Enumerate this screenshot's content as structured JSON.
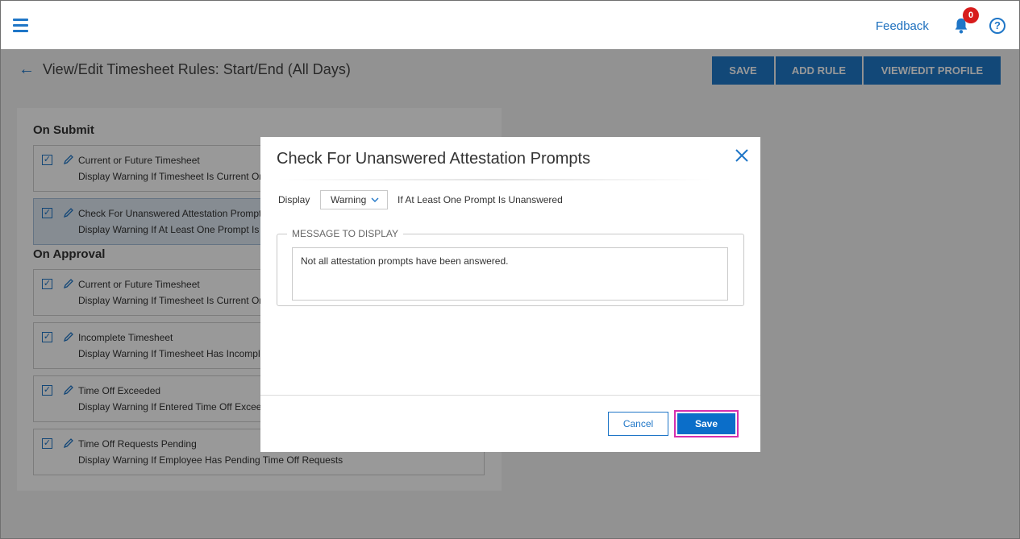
{
  "header": {
    "feedback_label": "Feedback",
    "notification_count": "0",
    "help_label": "?"
  },
  "page": {
    "title": "View/Edit Timesheet Rules: Start/End (All Days)",
    "buttons": {
      "save": "SAVE",
      "add_rule": "ADD RULE",
      "view_edit_profile": "VIEW/EDIT PROFILE"
    },
    "sections": [
      {
        "title": "On Submit",
        "rules": [
          {
            "title": "Current or Future Timesheet",
            "desc": "Display Warning If Timesheet Is Current Or Future"
          },
          {
            "title": "Check For Unanswered Attestation Prompts",
            "desc": "Display Warning If At Least One Prompt Is Unanswered"
          }
        ]
      },
      {
        "title": "On Approval",
        "rules": [
          {
            "title": "Current or Future Timesheet",
            "desc": "Display Warning If Timesheet Is Current Or Future"
          },
          {
            "title": "Incomplete Timesheet",
            "desc": "Display Warning If Timesheet Has Incomplete Entries"
          },
          {
            "title": "Time Off Exceeded",
            "desc": "Display Warning If Entered Time Off Exceeds Balance"
          },
          {
            "title": "Time Off Requests Pending",
            "desc": "Display Warning If Employee Has Pending Time Off Requests"
          }
        ]
      }
    ]
  },
  "modal": {
    "title": "Check For Unanswered Attestation Prompts",
    "display_label": "Display",
    "severity_value": "Warning",
    "condition_text": "If At Least One Prompt Is Unanswered",
    "message_legend": "MESSAGE TO DISPLAY",
    "message_text": "Not all attestation prompts have been answered.",
    "cancel_label": "Cancel",
    "save_label": "Save"
  },
  "colors": {
    "brand_blue": "#1f76c7",
    "primary_button": "#0b6ec9",
    "badge_red": "#d71c1c",
    "focus_outline": "#d62fae"
  }
}
